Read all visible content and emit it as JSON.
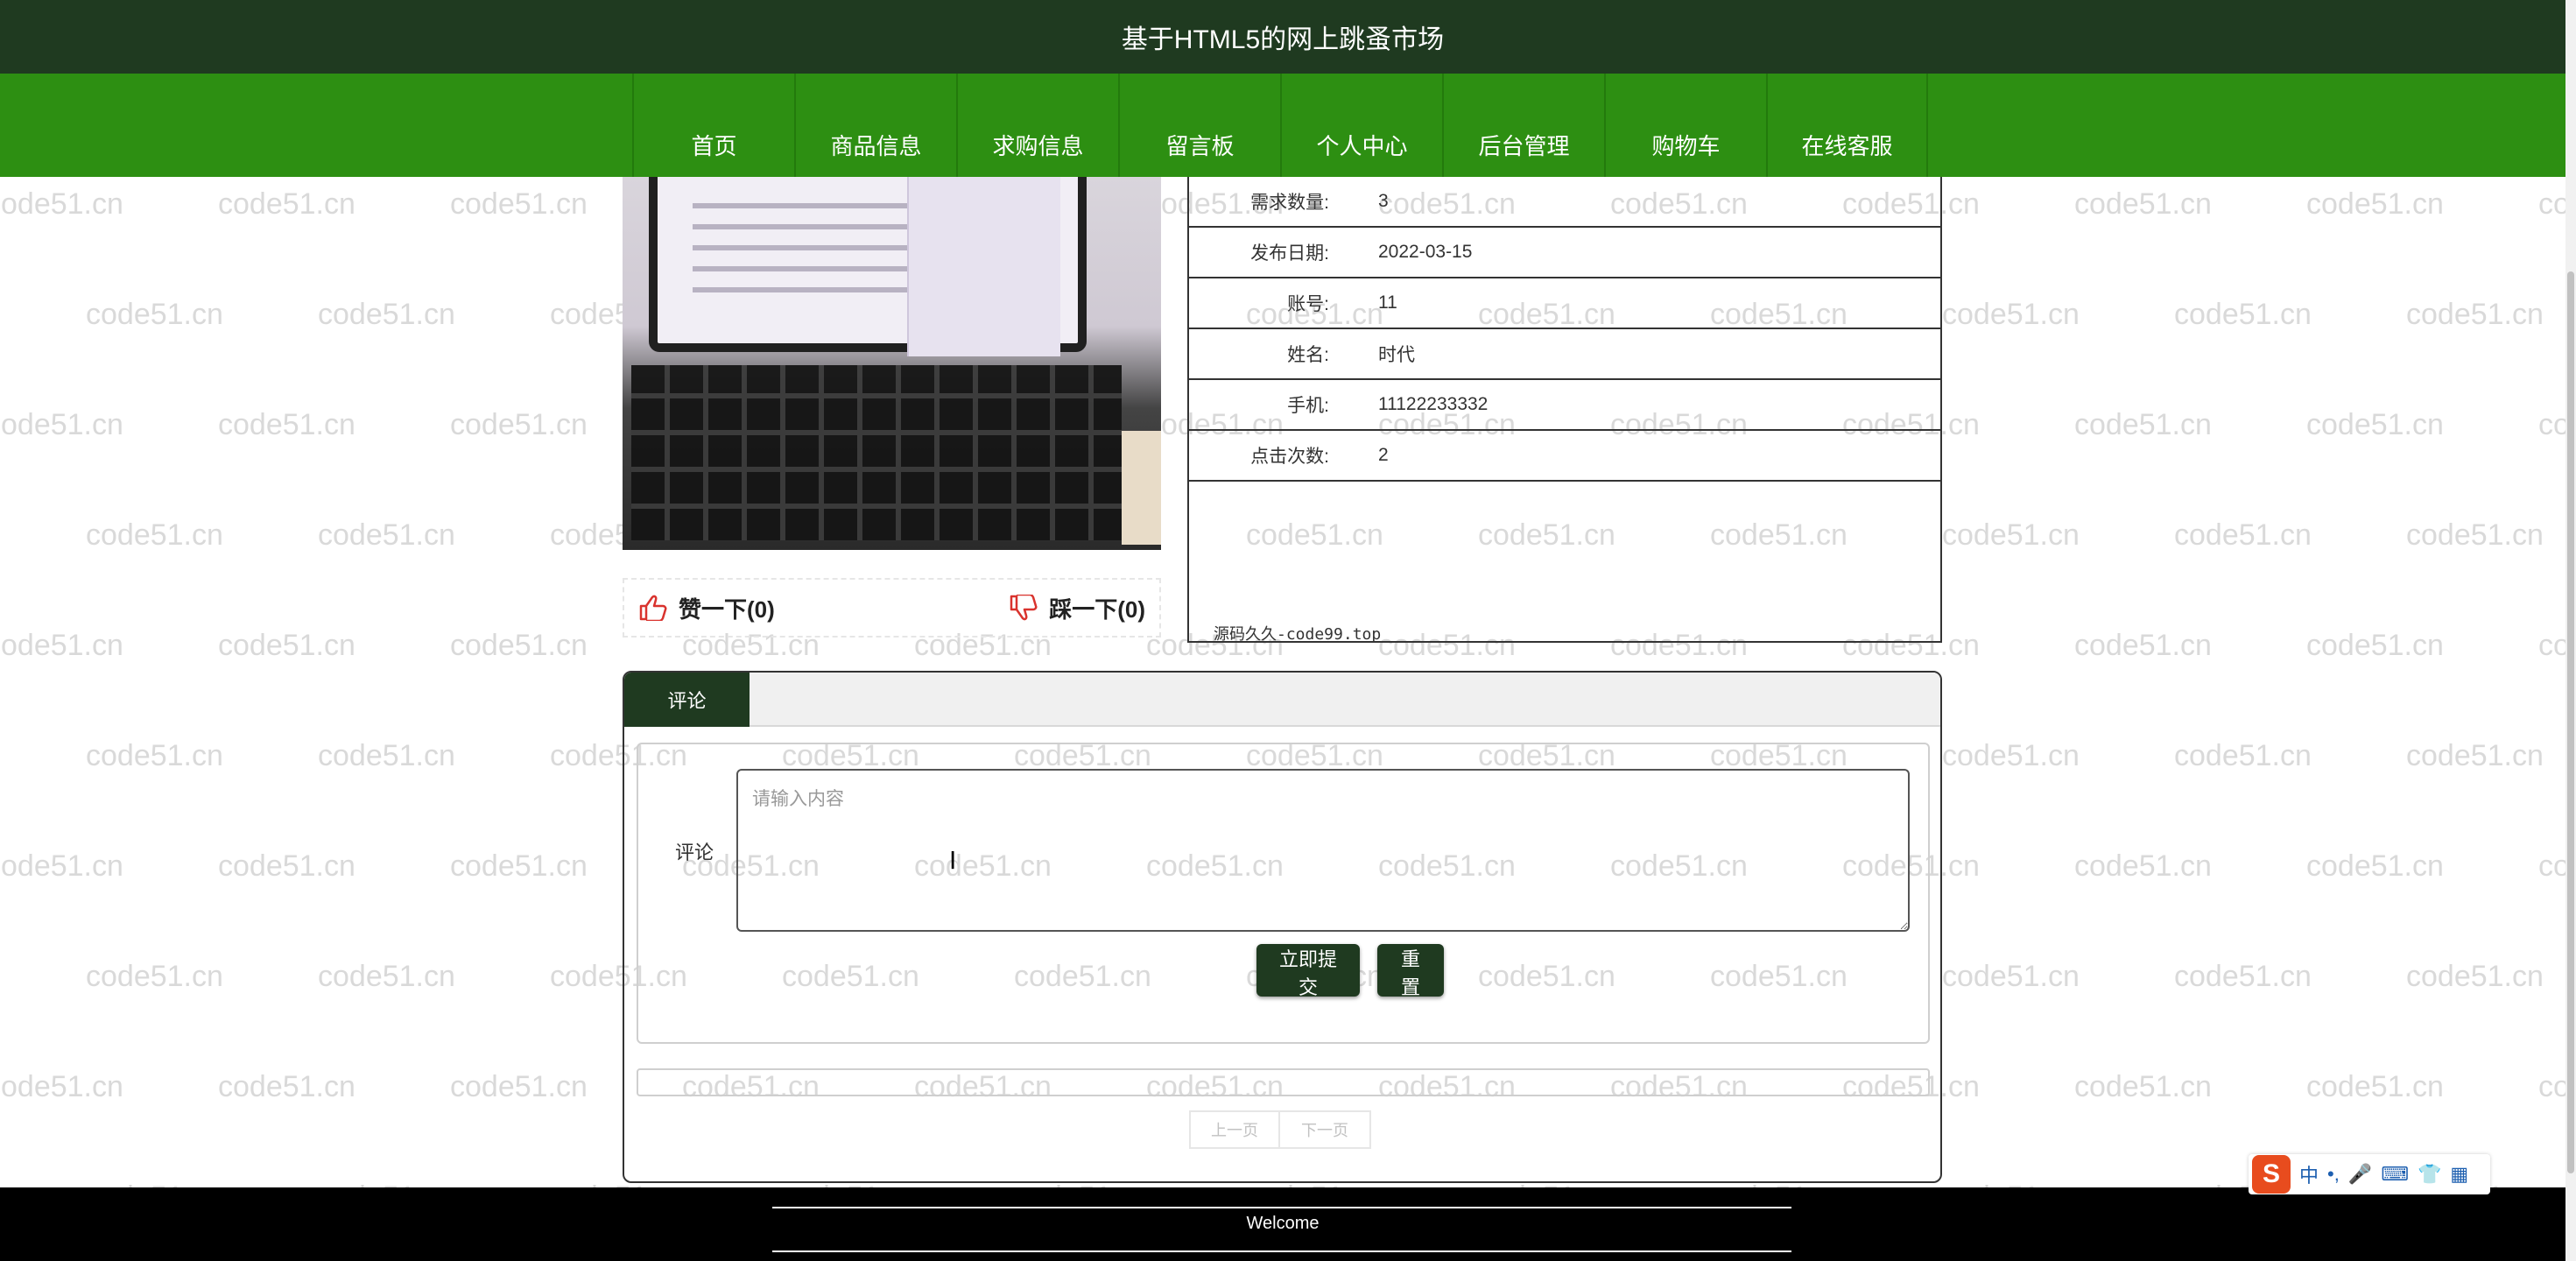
{
  "header": {
    "title": "基于HTML5的网上跳蚤市场"
  },
  "nav": {
    "items": [
      {
        "label": "首页"
      },
      {
        "label": "商品信息"
      },
      {
        "label": "求购信息"
      },
      {
        "label": "留言板"
      },
      {
        "label": "个人中心"
      },
      {
        "label": "后台管理"
      },
      {
        "label": "购物车"
      },
      {
        "label": "在线客服"
      }
    ]
  },
  "details": {
    "rows": [
      {
        "label": "需求数量:",
        "value": "3"
      },
      {
        "label": "发布日期:",
        "value": "2022-03-15"
      },
      {
        "label": "账号:",
        "value": "11"
      },
      {
        "label": "姓名:",
        "value": "时代"
      },
      {
        "label": "手机:",
        "value": "11122233332"
      },
      {
        "label": "点击次数:",
        "value": "2"
      }
    ],
    "source_note": "源码久久-code99.top"
  },
  "vote": {
    "like_label": "赞一下(0)",
    "dislike_label": "踩一下(0)"
  },
  "comment": {
    "tab_label": "评论",
    "field_label": "评论",
    "placeholder": "请输入内容",
    "submit_label": "立即提交",
    "reset_label": "重置"
  },
  "pager": {
    "prev_label": "上一页",
    "next_label": "下一页"
  },
  "footer": {
    "text": "Welcome"
  },
  "watermark": {
    "text": "code51.cn"
  },
  "ime": {
    "chars": [
      "中",
      "•,",
      "🎤",
      "⌨",
      "👕",
      "▦"
    ],
    "logo": "S"
  },
  "colors": {
    "header_bg": "#1f3a20",
    "nav_bg": "#2d8f12",
    "button_bg": "#1f3a20",
    "footer_bg": "#000000",
    "like_icon": "#d9332e"
  }
}
